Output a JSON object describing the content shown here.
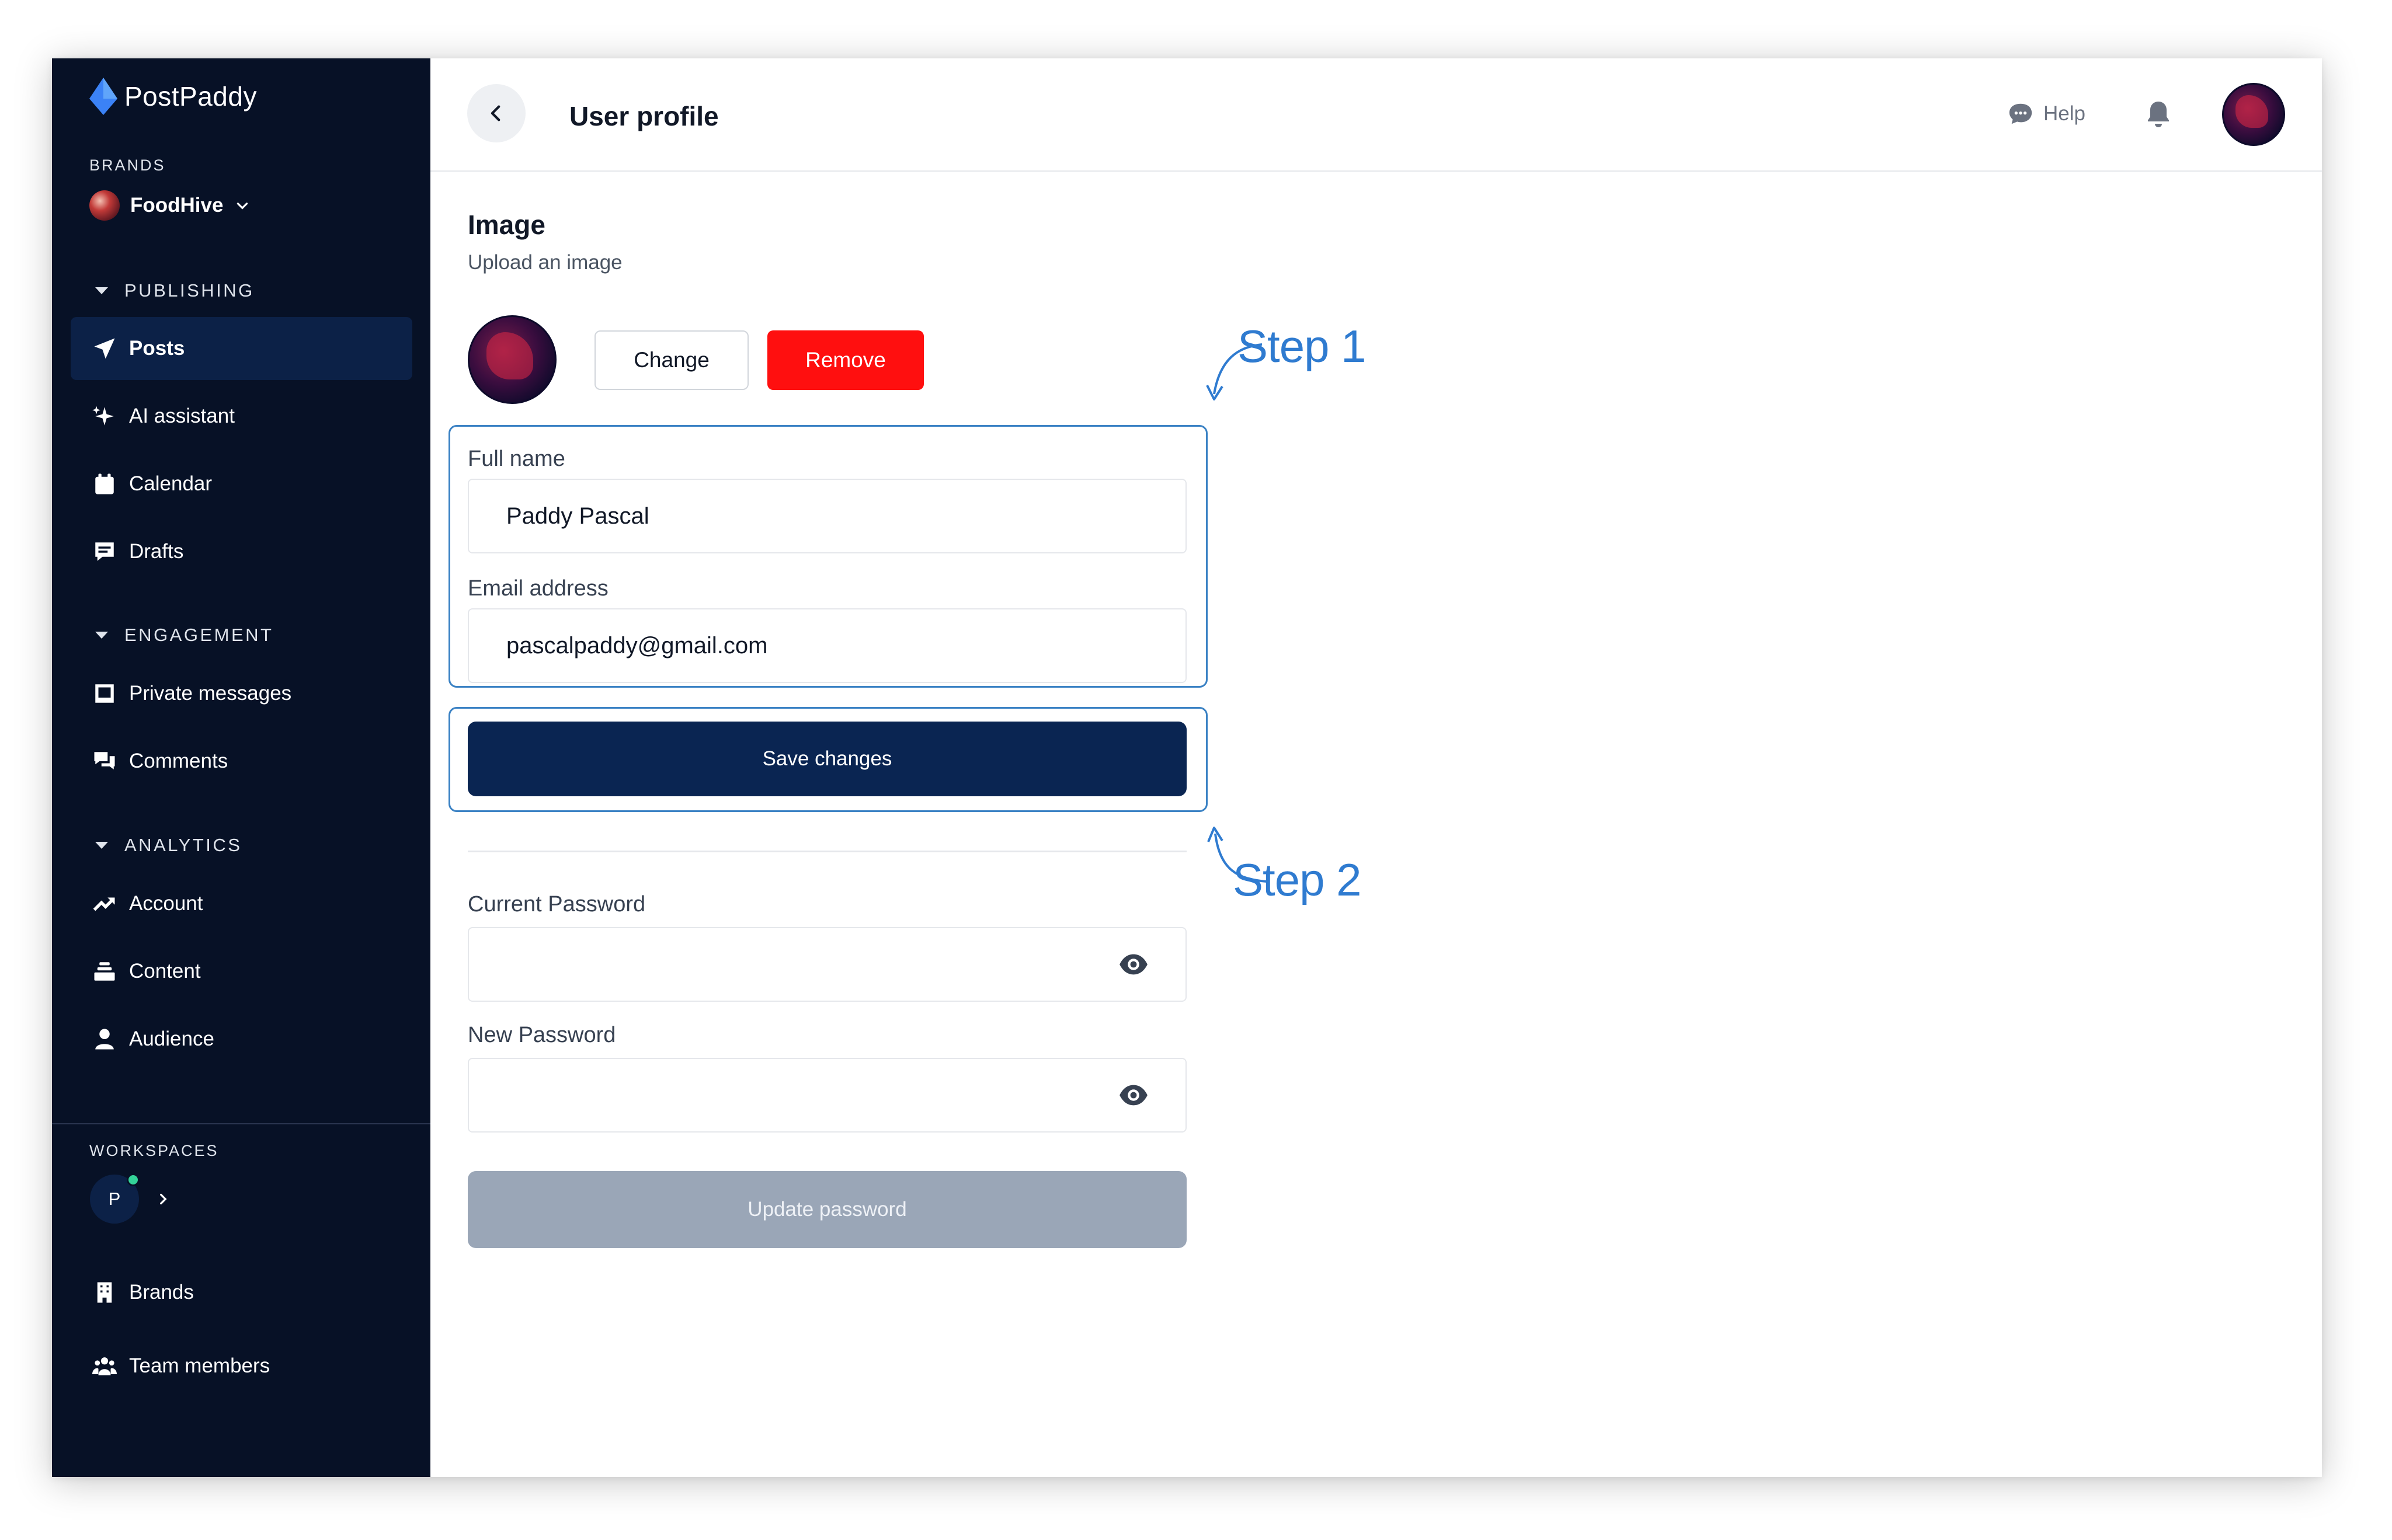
{
  "app": {
    "name": "PostPaddy"
  },
  "sidebar": {
    "brands_label": "BRANDS",
    "brand_name": "FoodHive",
    "groups": {
      "publishing": "PUBLISHING",
      "engagement": "ENGAGEMENT",
      "analytics": "ANALYTICS"
    },
    "items": {
      "posts": "Posts",
      "ai_assistant": "AI assistant",
      "calendar": "Calendar",
      "drafts": "Drafts",
      "private_messages": "Private messages",
      "comments": "Comments",
      "account": "Account",
      "content": "Content",
      "audience": "Audience",
      "brands": "Brands",
      "team_members": "Team members"
    },
    "workspaces_label": "WORKSPACES",
    "workspace_initial": "P"
  },
  "header": {
    "title": "User profile",
    "help_label": "Help"
  },
  "profile": {
    "image_title": "Image",
    "image_subtitle": "Upload an image",
    "change_label": "Change",
    "remove_label": "Remove",
    "full_name_label": "Full name",
    "full_name_value": "Paddy Pascal",
    "email_label": "Email address",
    "email_value": "pascalpaddy@gmail.com",
    "save_label": "Save changes"
  },
  "password": {
    "current_label": "Current Password",
    "new_label": "New Password",
    "update_label": "Update password"
  },
  "annotations": {
    "step1": "Step 1",
    "step2": "Step 2"
  },
  "colors": {
    "sidebar_bg": "#071126",
    "active_item_bg": "#0c2147",
    "primary_button": "#0a2552",
    "danger_button": "#ff0f0f",
    "disabled_button": "#9aa6b7",
    "annotation": "#2f7bd0"
  }
}
